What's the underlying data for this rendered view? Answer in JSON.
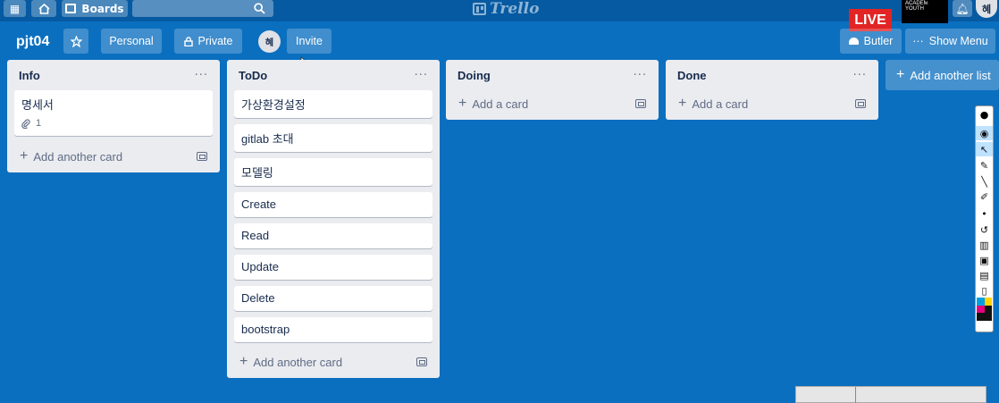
{
  "topbar": {
    "boards_label": "Boards",
    "logo_text": "Trello",
    "avatar_initial": "혜"
  },
  "overlay": {
    "live_label": "LIVE",
    "academy_text": "ACADEMY FOR YOUTH"
  },
  "board": {
    "title": "pjt04",
    "team_label": "Personal",
    "visibility_label": "Private",
    "member_initial": "혜",
    "invite_label": "Invite",
    "butler_label": "Butler",
    "show_menu_label": "Show Menu",
    "add_list_label": "Add another list"
  },
  "lists": [
    {
      "title": "Info",
      "cards": [
        {
          "title": "명세서",
          "attachments": "1"
        }
      ],
      "add_label": "Add another card"
    },
    {
      "title": "ToDo",
      "cards": [
        {
          "title": "가상환경설정"
        },
        {
          "title": "gitlab 초대"
        },
        {
          "title": "모델링"
        },
        {
          "title": "Create"
        },
        {
          "title": "Read"
        },
        {
          "title": "Update"
        },
        {
          "title": "Delete"
        },
        {
          "title": "bootstrap"
        }
      ],
      "add_label": "Add another card"
    },
    {
      "title": "Doing",
      "cards": [],
      "add_label": "Add a card"
    },
    {
      "title": "Done",
      "cards": [],
      "add_label": "Add a card"
    }
  ],
  "colors": {
    "board_background": "#0b6fbf",
    "top_bar": "#065aa2",
    "list_background": "#ebecf0",
    "live_red": "#e22424"
  },
  "icons": [
    "apps-grid-icon",
    "home-icon",
    "boards-icon",
    "search-icon",
    "bell-icon",
    "star-icon",
    "lock-icon",
    "butler-icon",
    "ellipsis-icon",
    "plus-icon",
    "paperclip-icon",
    "template-icon"
  ]
}
